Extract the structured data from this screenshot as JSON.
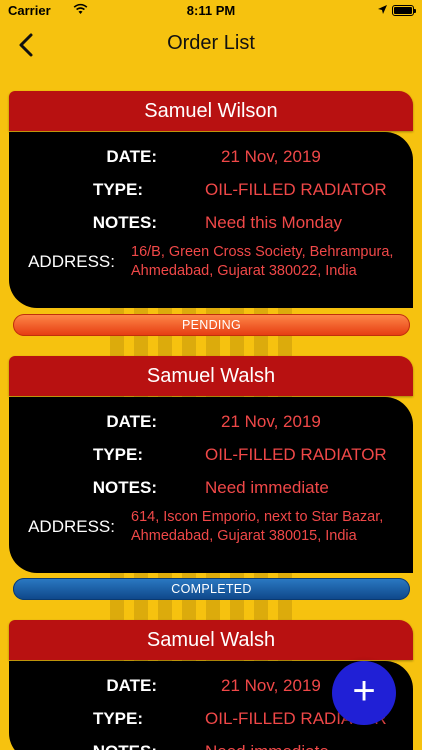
{
  "status_bar": {
    "carrier": "Carrier",
    "time": "8:11 PM"
  },
  "nav": {
    "title": "Order List"
  },
  "labels": {
    "date": "DATE:",
    "type": "TYPE:",
    "notes": "NOTES:",
    "address": "ADDRESS:"
  },
  "orders": [
    {
      "name": "Samuel Wilson",
      "date": "21 Nov, 2019",
      "type": "OIL-FILLED RADIATOR",
      "notes": "Need this Monday",
      "address": "16/B, Green Cross Society, Behrampura, Ahmedabad, Gujarat 380022, India",
      "status": "PENDING"
    },
    {
      "name": "Samuel Walsh",
      "date": "21 Nov, 2019",
      "type": "OIL-FILLED RADIATOR",
      "notes": "Need immediate",
      "address": "614, Iscon Emporio, next to Star Bazar, Ahmedabad, Gujarat 380015, India",
      "status": "COMPLETED"
    },
    {
      "name": "Samuel Walsh",
      "date": "21 Nov, 2019",
      "type": "OIL-FILLED RADIATOR",
      "notes": "Need immediate"
    }
  ],
  "fab": {
    "label": "+"
  },
  "colors": {
    "background": "#f6c20f",
    "card_header": "#b81111",
    "card_body": "#000000",
    "value_text": "#f04848",
    "pending": "#f05a20",
    "completed": "#1a5ca8",
    "fab": "#2020d6"
  }
}
